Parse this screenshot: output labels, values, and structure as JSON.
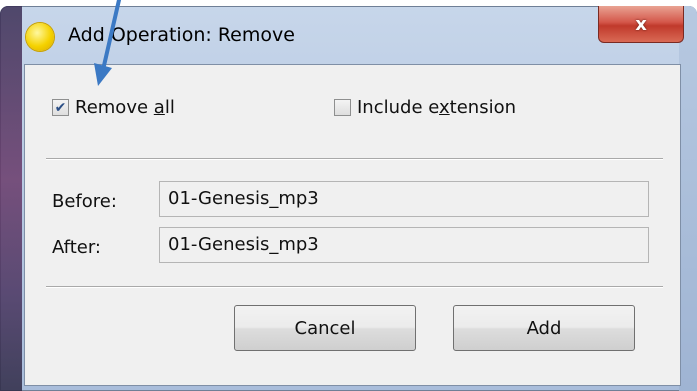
{
  "window": {
    "title": "Add Operation: Remove",
    "close_glyph": "x"
  },
  "options": {
    "remove_all": {
      "label_pre": "Remove ",
      "label_accel": "a",
      "label_post": "ll",
      "checked": true
    },
    "include_extension": {
      "label_pre": "Include e",
      "label_accel": "x",
      "label_post": "tension",
      "checked": false
    }
  },
  "preview": {
    "before_label": "Before:",
    "before_value": "01-Genesis_mp3",
    "after_label": "After:",
    "after_value": "01-Genesis_mp3"
  },
  "buttons": {
    "cancel": "Cancel",
    "add": "Add"
  },
  "colors": {
    "arrow": "#3b79c4",
    "check": "#2c4f86"
  },
  "icons": {
    "app": "app-circle-icon",
    "close": "close-icon",
    "check": "checkmark-icon",
    "annotation": "annotation-arrow-icon"
  }
}
